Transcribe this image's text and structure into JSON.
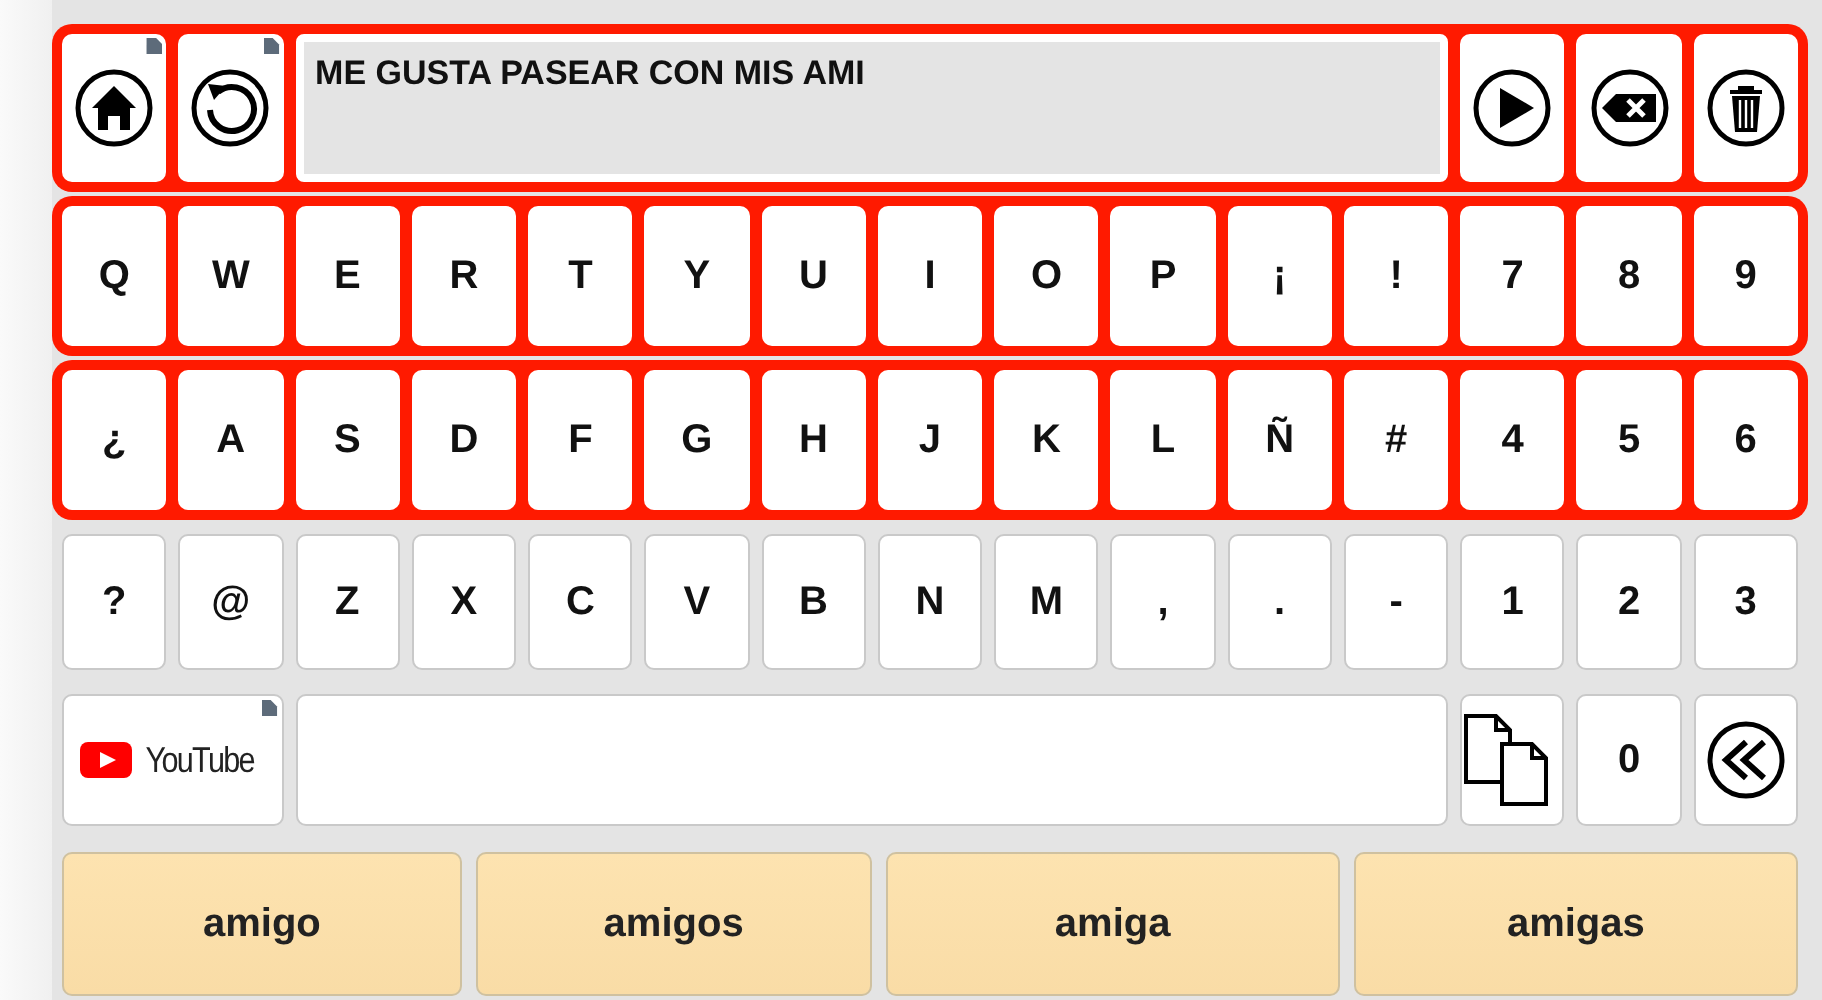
{
  "rows": [
    {
      "highlighted": true,
      "cells": [
        {
          "kind": "home",
          "corner_mark": true
        },
        {
          "kind": "undo",
          "corner_mark": true
        },
        {
          "kind": "display",
          "text": "ME GUSTA PASEAR CON MIS AMI"
        },
        {
          "kind": "play",
          "corner_mark": false
        },
        {
          "kind": "backspace",
          "corner_mark": false
        },
        {
          "kind": "trash",
          "corner_mark": false
        }
      ]
    },
    {
      "highlighted": true,
      "cells": [
        {
          "kind": "key",
          "label": "Q"
        },
        {
          "kind": "key",
          "label": "W"
        },
        {
          "kind": "key",
          "label": "E"
        },
        {
          "kind": "key",
          "label": "R"
        },
        {
          "kind": "key",
          "label": "T"
        },
        {
          "kind": "key",
          "label": "Y"
        },
        {
          "kind": "key",
          "label": "U"
        },
        {
          "kind": "key",
          "label": "I"
        },
        {
          "kind": "key",
          "label": "O"
        },
        {
          "kind": "key",
          "label": "P"
        },
        {
          "kind": "key",
          "label": "¡"
        },
        {
          "kind": "key",
          "label": "!"
        },
        {
          "kind": "key",
          "label": "7"
        },
        {
          "kind": "key",
          "label": "8"
        },
        {
          "kind": "key",
          "label": "9"
        }
      ]
    },
    {
      "highlighted": true,
      "cells": [
        {
          "kind": "key",
          "label": "¿"
        },
        {
          "kind": "key",
          "label": "A"
        },
        {
          "kind": "key",
          "label": "S"
        },
        {
          "kind": "key",
          "label": "D"
        },
        {
          "kind": "key",
          "label": "F"
        },
        {
          "kind": "key",
          "label": "G"
        },
        {
          "kind": "key",
          "label": "H"
        },
        {
          "kind": "key",
          "label": "J"
        },
        {
          "kind": "key",
          "label": "K"
        },
        {
          "kind": "key",
          "label": "L"
        },
        {
          "kind": "key",
          "label": "Ñ"
        },
        {
          "kind": "key",
          "label": "#"
        },
        {
          "kind": "key",
          "label": "4"
        },
        {
          "kind": "key",
          "label": "5"
        },
        {
          "kind": "key",
          "label": "6"
        }
      ]
    },
    {
      "highlighted": false,
      "cells": [
        {
          "kind": "key",
          "label": "?"
        },
        {
          "kind": "key",
          "label": "@"
        },
        {
          "kind": "key",
          "label": "Z"
        },
        {
          "kind": "key",
          "label": "X"
        },
        {
          "kind": "key",
          "label": "C"
        },
        {
          "kind": "key",
          "label": "V"
        },
        {
          "kind": "key",
          "label": "B"
        },
        {
          "kind": "key",
          "label": "N"
        },
        {
          "kind": "key",
          "label": "M"
        },
        {
          "kind": "key",
          "label": ","
        },
        {
          "kind": "key",
          "label": "."
        },
        {
          "kind": "key",
          "label": "-"
        },
        {
          "kind": "key",
          "label": "1"
        },
        {
          "kind": "key",
          "label": "2"
        },
        {
          "kind": "key",
          "label": "3"
        }
      ]
    },
    {
      "highlighted": false,
      "cells": [
        {
          "kind": "youtube",
          "label": "YouTube",
          "corner_mark": true
        },
        {
          "kind": "field"
        },
        {
          "kind": "copy"
        },
        {
          "kind": "key",
          "label": "0"
        },
        {
          "kind": "rewind"
        }
      ]
    }
  ],
  "suggestions": [
    "amigo",
    "amigos",
    "amiga",
    "amigas"
  ]
}
